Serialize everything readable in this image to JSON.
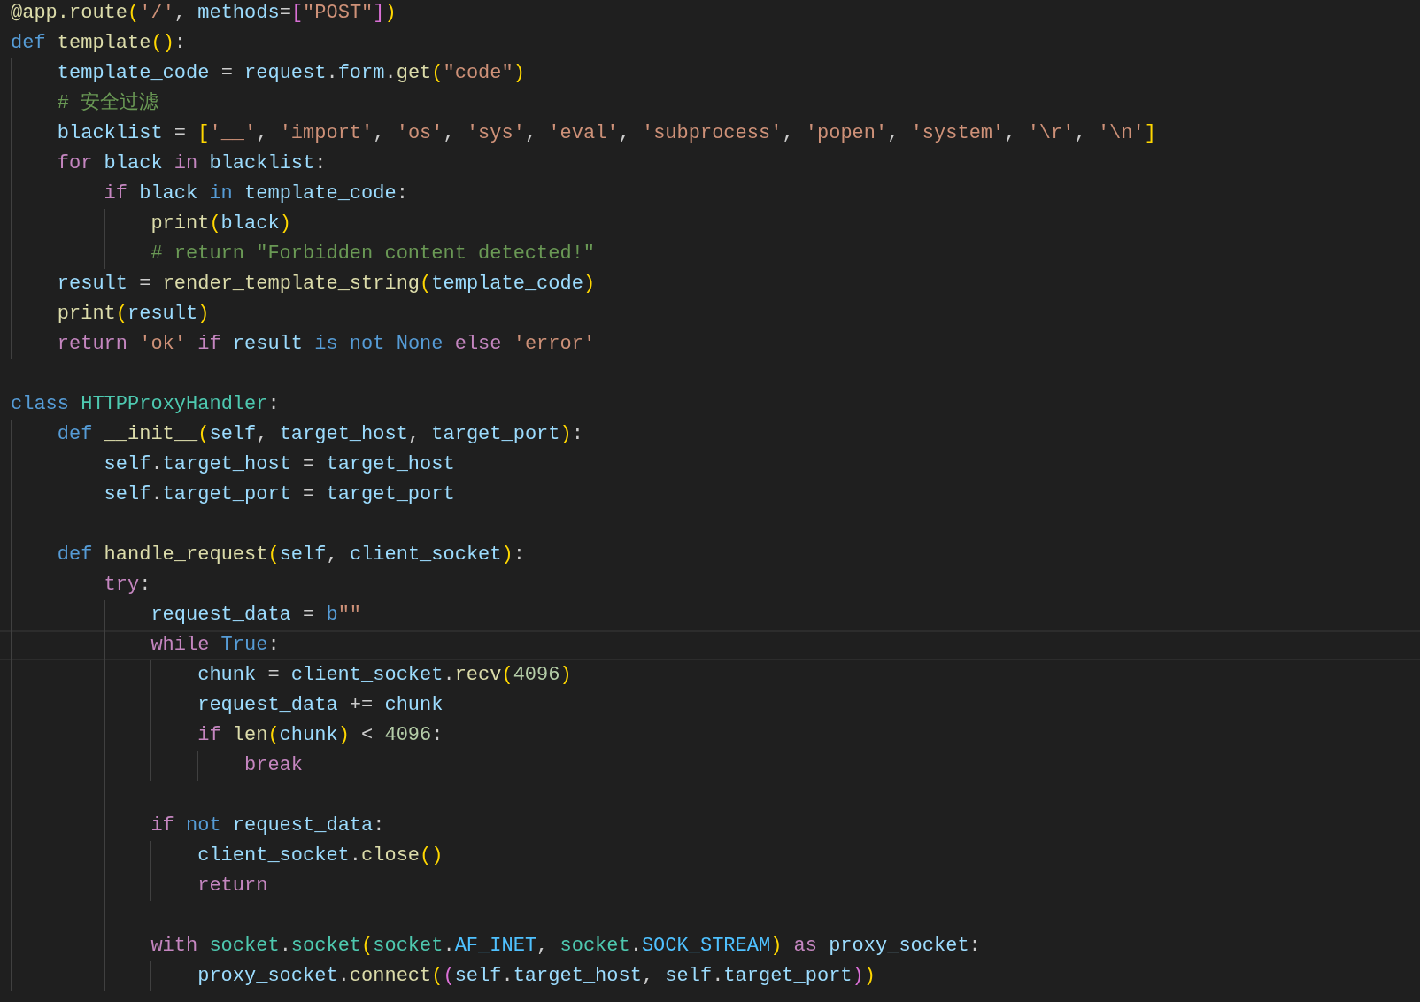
{
  "lines": [
    {
      "current": false,
      "gap_before": false,
      "tokens": [
        {
          "kind": "fn",
          "text": "@app.route"
        },
        {
          "kind": "br1",
          "text": "("
        },
        {
          "kind": "str",
          "text": "'/'"
        },
        {
          "kind": "plain",
          "text": ", "
        },
        {
          "kind": "var",
          "text": "methods"
        },
        {
          "kind": "plain",
          "text": "="
        },
        {
          "kind": "br2",
          "text": "["
        },
        {
          "kind": "str",
          "text": "\"POST\""
        },
        {
          "kind": "br2",
          "text": "]"
        },
        {
          "kind": "br1",
          "text": ")"
        }
      ]
    },
    {
      "current": false,
      "gap_before": false,
      "tokens": [
        {
          "kind": "store",
          "text": "def "
        },
        {
          "kind": "fn",
          "text": "template"
        },
        {
          "kind": "br1",
          "text": "()"
        },
        {
          "kind": "plain",
          "text": ":"
        }
      ],
      "children": [
        {
          "current": false,
          "gap_before": false,
          "tokens": [
            {
              "kind": "var",
              "text": "template_code"
            },
            {
              "kind": "plain",
              "text": " = "
            },
            {
              "kind": "var",
              "text": "request"
            },
            {
              "kind": "plain",
              "text": "."
            },
            {
              "kind": "var",
              "text": "form"
            },
            {
              "kind": "plain",
              "text": "."
            },
            {
              "kind": "fn",
              "text": "get"
            },
            {
              "kind": "br1",
              "text": "("
            },
            {
              "kind": "str",
              "text": "\"code\""
            },
            {
              "kind": "br1",
              "text": ")"
            }
          ]
        },
        {
          "current": false,
          "gap_before": false,
          "tokens": [
            {
              "kind": "com",
              "text": "# 安全过滤"
            }
          ]
        },
        {
          "current": false,
          "gap_before": false,
          "tokens": [
            {
              "kind": "var",
              "text": "blacklist"
            },
            {
              "kind": "plain",
              "text": " = "
            },
            {
              "kind": "br1",
              "text": "["
            },
            {
              "kind": "str",
              "text": "'__'"
            },
            {
              "kind": "plain",
              "text": ", "
            },
            {
              "kind": "str",
              "text": "'import'"
            },
            {
              "kind": "plain",
              "text": ", "
            },
            {
              "kind": "str",
              "text": "'os'"
            },
            {
              "kind": "plain",
              "text": ", "
            },
            {
              "kind": "str",
              "text": "'sys'"
            },
            {
              "kind": "plain",
              "text": ", "
            },
            {
              "kind": "str",
              "text": "'eval'"
            },
            {
              "kind": "plain",
              "text": ", "
            },
            {
              "kind": "str",
              "text": "'subprocess'"
            },
            {
              "kind": "plain",
              "text": ", "
            },
            {
              "kind": "str",
              "text": "'popen'"
            },
            {
              "kind": "plain",
              "text": ", "
            },
            {
              "kind": "str",
              "text": "'system'"
            },
            {
              "kind": "plain",
              "text": ", "
            },
            {
              "kind": "str",
              "text": "'\\r'"
            },
            {
              "kind": "plain",
              "text": ", "
            },
            {
              "kind": "str",
              "text": "'\\n'"
            },
            {
              "kind": "br1",
              "text": "]"
            }
          ]
        },
        {
          "current": false,
          "gap_before": false,
          "tokens": [
            {
              "kind": "ctrl",
              "text": "for "
            },
            {
              "kind": "var",
              "text": "black "
            },
            {
              "kind": "ctrl",
              "text": "in "
            },
            {
              "kind": "var",
              "text": "blacklist"
            },
            {
              "kind": "plain",
              "text": ":"
            }
          ],
          "children": [
            {
              "current": false,
              "gap_before": false,
              "tokens": [
                {
                  "kind": "ctrl",
                  "text": "if "
                },
                {
                  "kind": "var",
                  "text": "black "
                },
                {
                  "kind": "store",
                  "text": "in "
                },
                {
                  "kind": "var",
                  "text": "template_code"
                },
                {
                  "kind": "plain",
                  "text": ":"
                }
              ],
              "children": [
                {
                  "current": false,
                  "gap_before": false,
                  "tokens": [
                    {
                      "kind": "fn",
                      "text": "print"
                    },
                    {
                      "kind": "br1",
                      "text": "("
                    },
                    {
                      "kind": "var",
                      "text": "black"
                    },
                    {
                      "kind": "br1",
                      "text": ")"
                    }
                  ]
                },
                {
                  "current": false,
                  "gap_before": false,
                  "tokens": [
                    {
                      "kind": "com",
                      "text": "# return \"Forbidden content detected!\""
                    }
                  ]
                }
              ]
            }
          ]
        },
        {
          "current": false,
          "gap_before": false,
          "tokens": [
            {
              "kind": "var",
              "text": "result"
            },
            {
              "kind": "plain",
              "text": " = "
            },
            {
              "kind": "fn",
              "text": "render_template_string"
            },
            {
              "kind": "br1",
              "text": "("
            },
            {
              "kind": "var",
              "text": "template_code"
            },
            {
              "kind": "br1",
              "text": ")"
            }
          ]
        },
        {
          "current": false,
          "gap_before": false,
          "tokens": [
            {
              "kind": "fn",
              "text": "print"
            },
            {
              "kind": "br1",
              "text": "("
            },
            {
              "kind": "var",
              "text": "result"
            },
            {
              "kind": "br1",
              "text": ")"
            }
          ]
        },
        {
          "current": false,
          "gap_before": false,
          "tokens": [
            {
              "kind": "ctrl",
              "text": "return "
            },
            {
              "kind": "str",
              "text": "'ok' "
            },
            {
              "kind": "ctrl",
              "text": "if "
            },
            {
              "kind": "var",
              "text": "result "
            },
            {
              "kind": "store",
              "text": "is not None "
            },
            {
              "kind": "ctrl",
              "text": "else "
            },
            {
              "kind": "str",
              "text": "'error'"
            }
          ]
        }
      ]
    },
    {
      "current": false,
      "gap_before": true,
      "tokens": [
        {
          "kind": "store",
          "text": "class "
        },
        {
          "kind": "cls",
          "text": "HTTPProxyHandler"
        },
        {
          "kind": "plain",
          "text": ":"
        }
      ],
      "children": [
        {
          "current": false,
          "gap_before": false,
          "tokens": [
            {
              "kind": "store",
              "text": "def "
            },
            {
              "kind": "fn",
              "text": "__init__"
            },
            {
              "kind": "br1",
              "text": "("
            },
            {
              "kind": "var",
              "text": "self"
            },
            {
              "kind": "plain",
              "text": ", "
            },
            {
              "kind": "var",
              "text": "target_host"
            },
            {
              "kind": "plain",
              "text": ", "
            },
            {
              "kind": "var",
              "text": "target_port"
            },
            {
              "kind": "br1",
              "text": ")"
            },
            {
              "kind": "plain",
              "text": ":"
            }
          ],
          "children": [
            {
              "current": false,
              "gap_before": false,
              "tokens": [
                {
                  "kind": "var",
                  "text": "self"
                },
                {
                  "kind": "plain",
                  "text": "."
                },
                {
                  "kind": "var",
                  "text": "target_host"
                },
                {
                  "kind": "plain",
                  "text": " = "
                },
                {
                  "kind": "var",
                  "text": "target_host"
                }
              ]
            },
            {
              "current": false,
              "gap_before": false,
              "tokens": [
                {
                  "kind": "var",
                  "text": "self"
                },
                {
                  "kind": "plain",
                  "text": "."
                },
                {
                  "kind": "var",
                  "text": "target_port"
                },
                {
                  "kind": "plain",
                  "text": " = "
                },
                {
                  "kind": "var",
                  "text": "target_port"
                }
              ]
            }
          ]
        },
        {
          "current": false,
          "gap_before": true,
          "tokens": [
            {
              "kind": "store",
              "text": "def "
            },
            {
              "kind": "fn",
              "text": "handle_request"
            },
            {
              "kind": "br1",
              "text": "("
            },
            {
              "kind": "var",
              "text": "self"
            },
            {
              "kind": "plain",
              "text": ", "
            },
            {
              "kind": "var",
              "text": "client_socket"
            },
            {
              "kind": "br1",
              "text": ")"
            },
            {
              "kind": "plain",
              "text": ":"
            }
          ],
          "children": [
            {
              "current": false,
              "gap_before": false,
              "tokens": [
                {
                  "kind": "ctrl",
                  "text": "try"
                },
                {
                  "kind": "plain",
                  "text": ":"
                }
              ],
              "children": [
                {
                  "current": false,
                  "gap_before": false,
                  "tokens": [
                    {
                      "kind": "var",
                      "text": "request_data"
                    },
                    {
                      "kind": "plain",
                      "text": " = "
                    },
                    {
                      "kind": "store",
                      "text": "b"
                    },
                    {
                      "kind": "str",
                      "text": "\"\""
                    }
                  ]
                },
                {
                  "current": true,
                  "gap_before": false,
                  "tokens": [
                    {
                      "kind": "ctrl",
                      "text": "while "
                    },
                    {
                      "kind": "store",
                      "text": "True"
                    },
                    {
                      "kind": "plain",
                      "text": ":"
                    }
                  ],
                  "children": [
                    {
                      "current": false,
                      "gap_before": false,
                      "tokens": [
                        {
                          "kind": "var",
                          "text": "chunk"
                        },
                        {
                          "kind": "plain",
                          "text": " = "
                        },
                        {
                          "kind": "var",
                          "text": "client_socket"
                        },
                        {
                          "kind": "plain",
                          "text": "."
                        },
                        {
                          "kind": "fn",
                          "text": "recv"
                        },
                        {
                          "kind": "br1",
                          "text": "("
                        },
                        {
                          "kind": "num",
                          "text": "4096"
                        },
                        {
                          "kind": "br1",
                          "text": ")"
                        }
                      ]
                    },
                    {
                      "current": false,
                      "gap_before": false,
                      "tokens": [
                        {
                          "kind": "var",
                          "text": "request_data"
                        },
                        {
                          "kind": "plain",
                          "text": " += "
                        },
                        {
                          "kind": "var",
                          "text": "chunk"
                        }
                      ]
                    },
                    {
                      "current": false,
                      "gap_before": false,
                      "tokens": [
                        {
                          "kind": "ctrl",
                          "text": "if "
                        },
                        {
                          "kind": "fn",
                          "text": "len"
                        },
                        {
                          "kind": "br1",
                          "text": "("
                        },
                        {
                          "kind": "var",
                          "text": "chunk"
                        },
                        {
                          "kind": "br1",
                          "text": ")"
                        },
                        {
                          "kind": "plain",
                          "text": " < "
                        },
                        {
                          "kind": "num",
                          "text": "4096"
                        },
                        {
                          "kind": "plain",
                          "text": ":"
                        }
                      ],
                      "children": [
                        {
                          "current": false,
                          "gap_before": false,
                          "tokens": [
                            {
                              "kind": "ctrl",
                              "text": "break"
                            }
                          ]
                        }
                      ]
                    }
                  ]
                },
                {
                  "current": false,
                  "gap_before": true,
                  "tokens": [
                    {
                      "kind": "ctrl",
                      "text": "if "
                    },
                    {
                      "kind": "store",
                      "text": "not "
                    },
                    {
                      "kind": "var",
                      "text": "request_data"
                    },
                    {
                      "kind": "plain",
                      "text": ":"
                    }
                  ],
                  "children": [
                    {
                      "current": false,
                      "gap_before": false,
                      "tokens": [
                        {
                          "kind": "var",
                          "text": "client_socket"
                        },
                        {
                          "kind": "plain",
                          "text": "."
                        },
                        {
                          "kind": "fn",
                          "text": "close"
                        },
                        {
                          "kind": "br1",
                          "text": "()"
                        }
                      ]
                    },
                    {
                      "current": false,
                      "gap_before": false,
                      "tokens": [
                        {
                          "kind": "ctrl",
                          "text": "return"
                        }
                      ]
                    }
                  ]
                },
                {
                  "current": false,
                  "gap_before": true,
                  "tokens": [
                    {
                      "kind": "ctrl",
                      "text": "with "
                    },
                    {
                      "kind": "cls",
                      "text": "socket"
                    },
                    {
                      "kind": "plain",
                      "text": "."
                    },
                    {
                      "kind": "cls",
                      "text": "socket"
                    },
                    {
                      "kind": "br1",
                      "text": "("
                    },
                    {
                      "kind": "cls",
                      "text": "socket"
                    },
                    {
                      "kind": "plain",
                      "text": "."
                    },
                    {
                      "kind": "const",
                      "text": "AF_INET"
                    },
                    {
                      "kind": "plain",
                      "text": ", "
                    },
                    {
                      "kind": "cls",
                      "text": "socket"
                    },
                    {
                      "kind": "plain",
                      "text": "."
                    },
                    {
                      "kind": "const",
                      "text": "SOCK_STREAM"
                    },
                    {
                      "kind": "br1",
                      "text": ")"
                    },
                    {
                      "kind": "ctrl",
                      "text": " as "
                    },
                    {
                      "kind": "var",
                      "text": "proxy_socket"
                    },
                    {
                      "kind": "plain",
                      "text": ":"
                    }
                  ],
                  "children": [
                    {
                      "current": false,
                      "gap_before": false,
                      "tokens": [
                        {
                          "kind": "var",
                          "text": "proxy_socket"
                        },
                        {
                          "kind": "plain",
                          "text": "."
                        },
                        {
                          "kind": "fn",
                          "text": "connect"
                        },
                        {
                          "kind": "br1",
                          "text": "("
                        },
                        {
                          "kind": "br2",
                          "text": "("
                        },
                        {
                          "kind": "var",
                          "text": "self"
                        },
                        {
                          "kind": "plain",
                          "text": "."
                        },
                        {
                          "kind": "var",
                          "text": "target_host"
                        },
                        {
                          "kind": "plain",
                          "text": ", "
                        },
                        {
                          "kind": "var",
                          "text": "self"
                        },
                        {
                          "kind": "plain",
                          "text": "."
                        },
                        {
                          "kind": "var",
                          "text": "target_port"
                        },
                        {
                          "kind": "br2",
                          "text": ")"
                        },
                        {
                          "kind": "br1",
                          "text": ")"
                        }
                      ]
                    }
                  ]
                }
              ]
            }
          ]
        }
      ]
    }
  ]
}
